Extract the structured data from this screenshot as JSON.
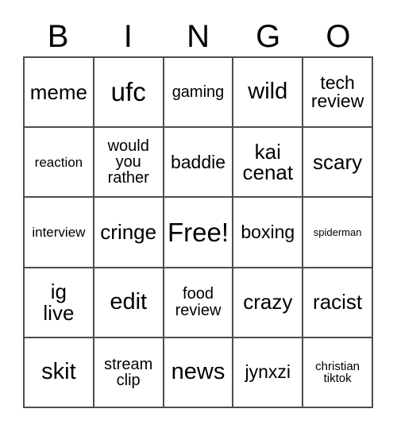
{
  "card": {
    "title_letters": [
      "B",
      "I",
      "N",
      "G",
      "O"
    ],
    "free_space_label": "Free!",
    "border_color": "#4d4d4d",
    "text_color": "#000000",
    "background_color": "#ffffff",
    "rows": [
      [
        {
          "label": "meme",
          "size": "2xl"
        },
        {
          "label": "ufc",
          "size": "4xl"
        },
        {
          "label": "gaming",
          "size": "lg"
        },
        {
          "label": "wild",
          "size": "3xl"
        },
        {
          "label": "tech\nreview",
          "size": "xl"
        }
      ],
      [
        {
          "label": "reaction",
          "size": "md"
        },
        {
          "label": "would\nyou\nrather",
          "size": "lg"
        },
        {
          "label": "baddie",
          "size": "xl"
        },
        {
          "label": "kai\ncenat",
          "size": "2xl"
        },
        {
          "label": "scary",
          "size": "2xl"
        }
      ],
      [
        {
          "label": "interview",
          "size": "md"
        },
        {
          "label": "cringe",
          "size": "2xl"
        },
        {
          "label": "Free!",
          "size": "4xl"
        },
        {
          "label": "boxing",
          "size": "xl"
        },
        {
          "label": "spiderman",
          "size": "xs"
        }
      ],
      [
        {
          "label": "ig\nlive",
          "size": "2xl"
        },
        {
          "label": "edit",
          "size": "3xl"
        },
        {
          "label": "food\nreview",
          "size": "lg"
        },
        {
          "label": "crazy",
          "size": "2xl"
        },
        {
          "label": "racist",
          "size": "2xl"
        }
      ],
      [
        {
          "label": "skit",
          "size": "3xl"
        },
        {
          "label": "stream\nclip",
          "size": "lg"
        },
        {
          "label": "news",
          "size": "3xl"
        },
        {
          "label": "jynxzi",
          "size": "xl"
        },
        {
          "label": "christian\ntiktok",
          "size": "sm"
        }
      ]
    ]
  }
}
